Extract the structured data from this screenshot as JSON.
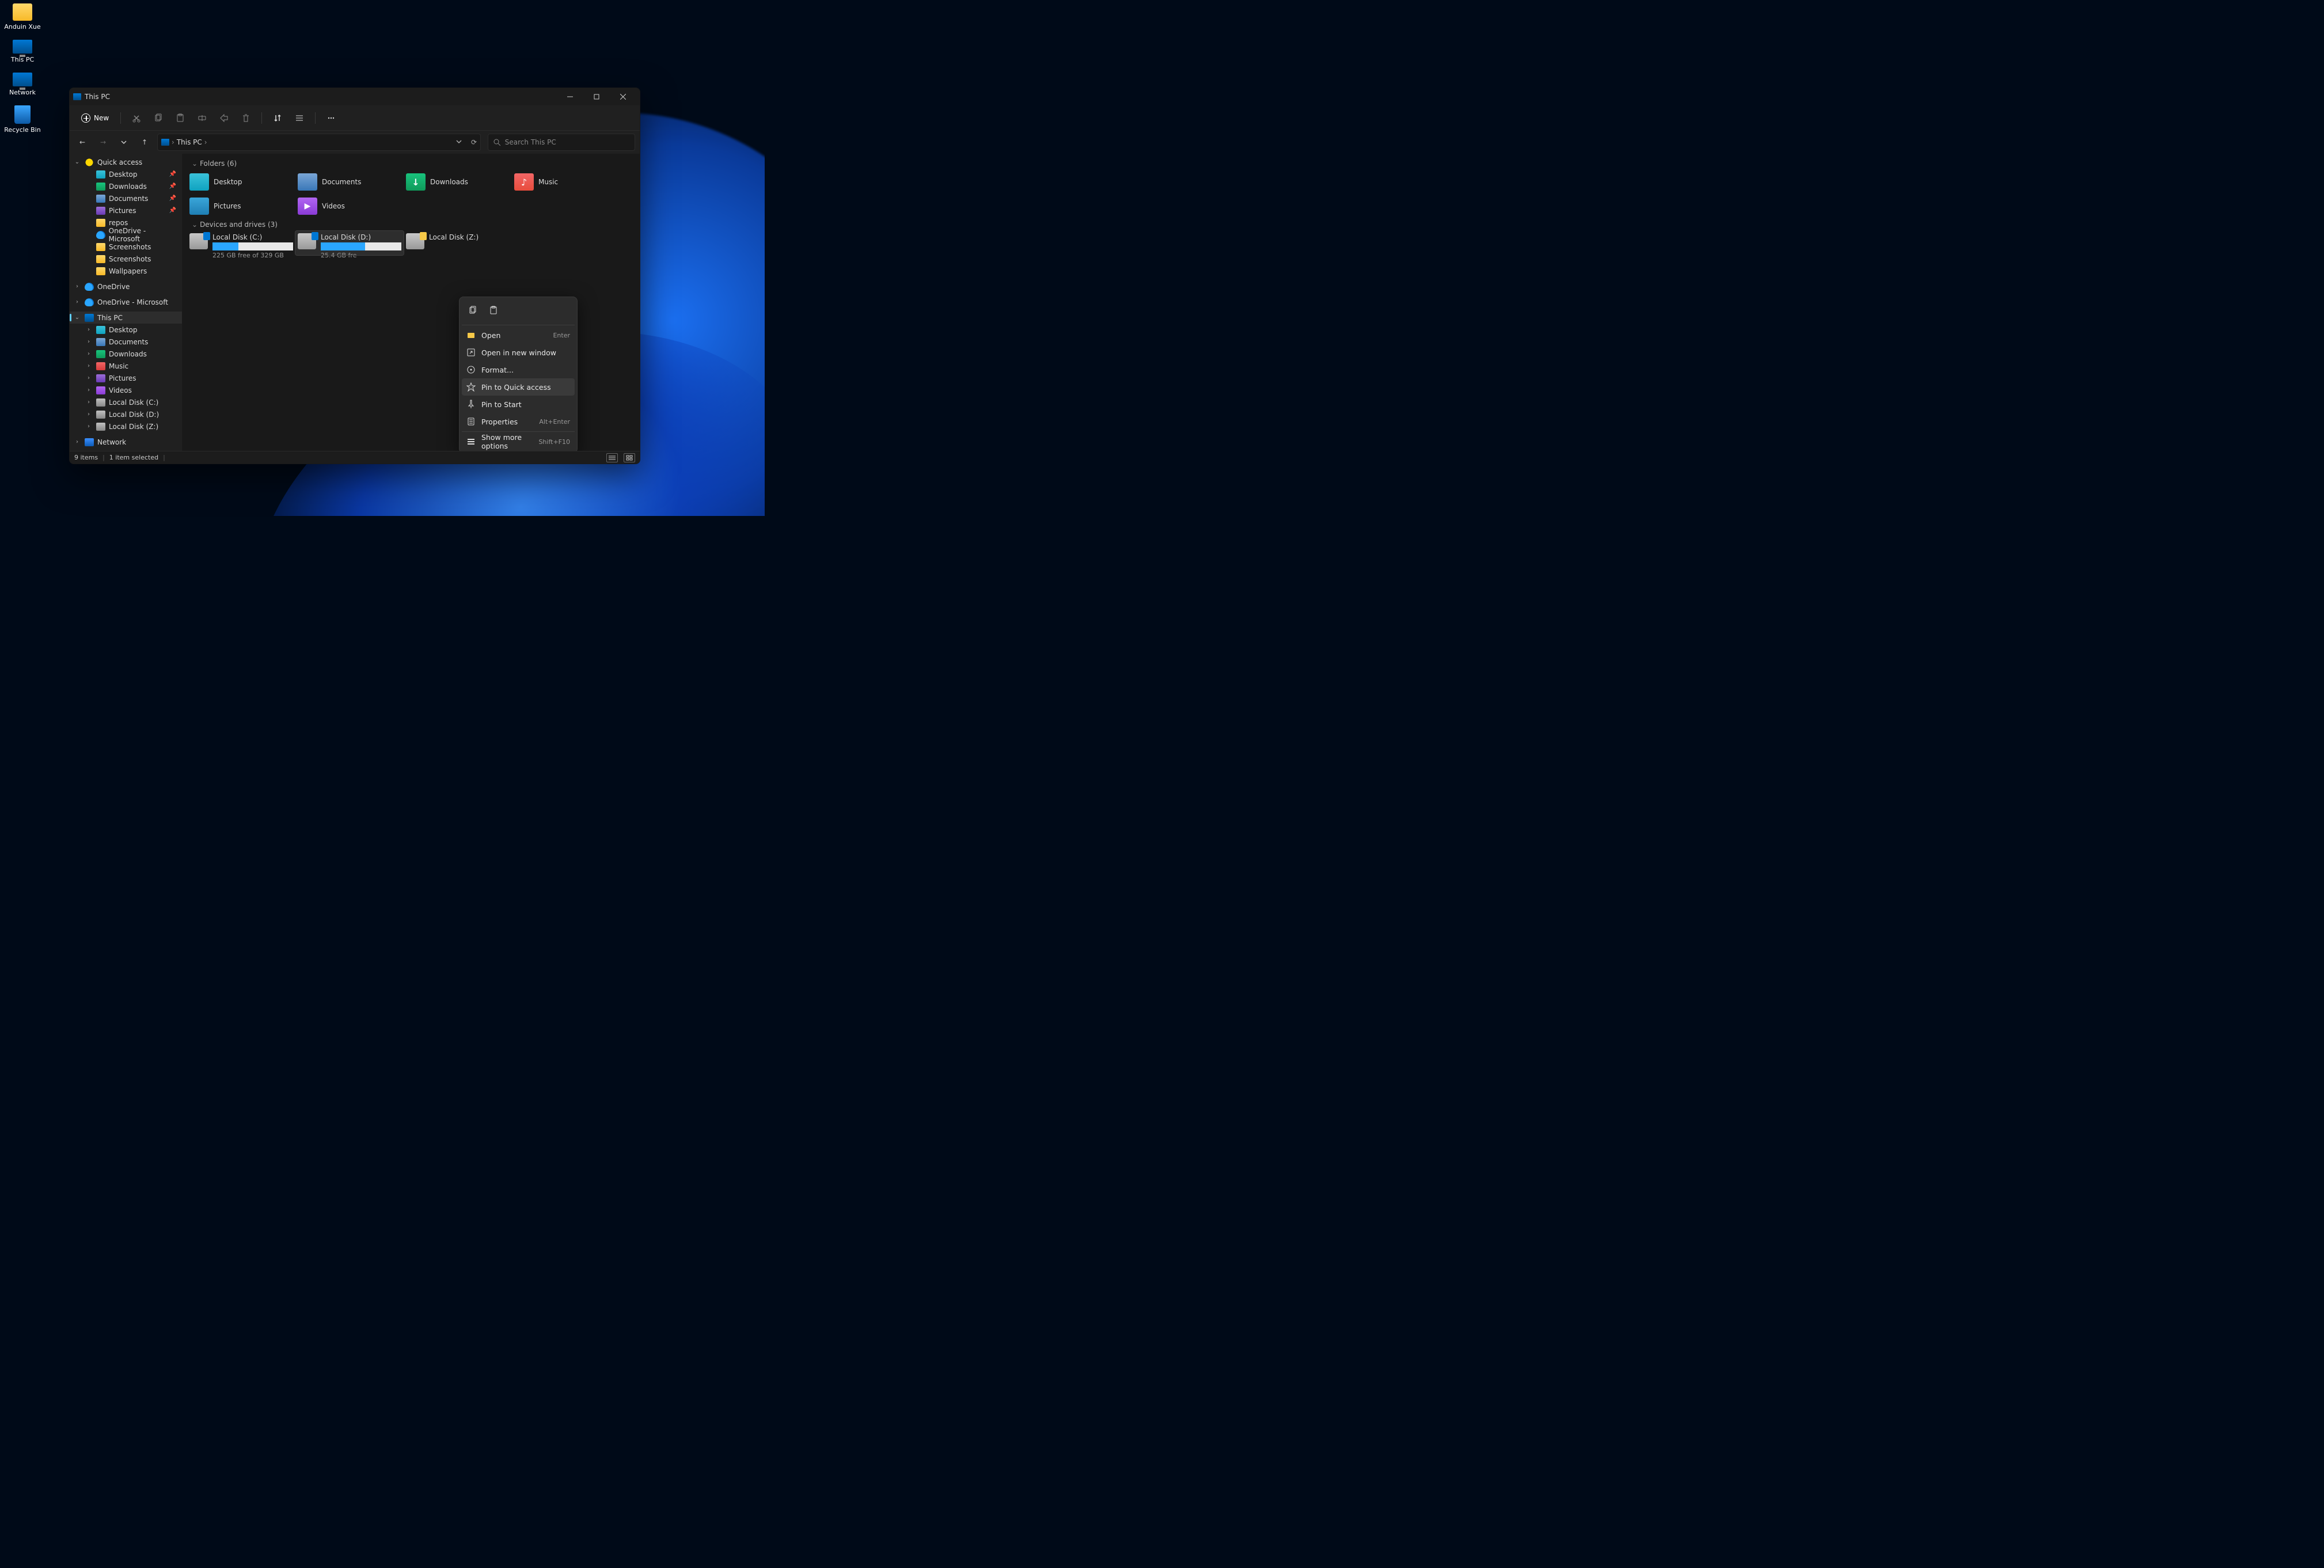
{
  "desktop": {
    "icons": [
      {
        "label": "Anduin Xue",
        "type": "folder"
      },
      {
        "label": "This PC",
        "type": "pc"
      },
      {
        "label": "Network",
        "type": "network"
      },
      {
        "label": "Recycle Bin",
        "type": "bin"
      }
    ]
  },
  "window": {
    "title": "This PC",
    "toolbar": {
      "new_label": "New"
    },
    "breadcrumb": {
      "root": "This PC"
    },
    "search_placeholder": "Search This PC",
    "sidebar": {
      "quick_access": {
        "label": "Quick access"
      },
      "qa_items": [
        {
          "label": "Desktop",
          "pinned": true,
          "cls": "ic-desktop"
        },
        {
          "label": "Downloads",
          "pinned": true,
          "cls": "ic-downloads"
        },
        {
          "label": "Documents",
          "pinned": true,
          "cls": "ic-documents"
        },
        {
          "label": "Pictures",
          "pinned": true,
          "cls": "ic-pictures"
        },
        {
          "label": "repos",
          "pinned": false,
          "cls": "ic-folder"
        },
        {
          "label": "OneDrive - Microsoft",
          "pinned": false,
          "cls": "ic-onedrive"
        },
        {
          "label": "Screenshots",
          "pinned": false,
          "cls": "ic-folder"
        },
        {
          "label": "Screenshots",
          "pinned": false,
          "cls": "ic-folder"
        },
        {
          "label": "Wallpapers",
          "pinned": false,
          "cls": "ic-folder"
        }
      ],
      "onedrive": {
        "label": "OneDrive"
      },
      "onedrive_ms": {
        "label": "OneDrive - Microsoft"
      },
      "thispc": {
        "label": "This PC"
      },
      "pc_items": [
        {
          "label": "Desktop",
          "cls": "ic-desktop"
        },
        {
          "label": "Documents",
          "cls": "ic-documents"
        },
        {
          "label": "Downloads",
          "cls": "ic-downloads"
        },
        {
          "label": "Music",
          "cls": "ic-music"
        },
        {
          "label": "Pictures",
          "cls": "ic-pictures"
        },
        {
          "label": "Videos",
          "cls": "ic-videos"
        },
        {
          "label": "Local Disk (C:)",
          "cls": "ic-disk"
        },
        {
          "label": "Local Disk (D:)",
          "cls": "ic-disk"
        },
        {
          "label": "Local Disk (Z:)",
          "cls": "ic-disk"
        }
      ],
      "network": {
        "label": "Network"
      }
    },
    "content": {
      "folders_header": "Folders (6)",
      "folders": [
        {
          "label": "Desktop",
          "cls": "fi-desktop"
        },
        {
          "label": "Documents",
          "cls": "fi-documents"
        },
        {
          "label": "Downloads",
          "cls": "fi-downloads"
        },
        {
          "label": "Music",
          "cls": "fi-music"
        },
        {
          "label": "Pictures",
          "cls": "fi-pictures"
        },
        {
          "label": "Videos",
          "cls": "fi-videos"
        }
      ],
      "drives_header": "Devices and drives (3)",
      "drives": [
        {
          "label": "Local Disk (C:)",
          "free": "225 GB free of 329 GB",
          "fill": 32,
          "locked": false
        },
        {
          "label": "Local Disk (D:)",
          "free": "25.4 GB fre",
          "fill": 55,
          "locked": false,
          "selected": true
        },
        {
          "label": "Local Disk (Z:)",
          "free": "",
          "fill": 0,
          "locked": true
        }
      ]
    },
    "statusbar": {
      "items_count": "9 items",
      "selection": "1 item selected"
    }
  },
  "context_menu": {
    "items": [
      {
        "label": "Open",
        "shortcut": "Enter",
        "icon": "open"
      },
      {
        "label": "Open in new window",
        "shortcut": "",
        "icon": "newwin"
      },
      {
        "label": "Format...",
        "shortcut": "",
        "icon": "format"
      },
      {
        "label": "Pin to Quick access",
        "shortcut": "",
        "icon": "star",
        "hover": true
      },
      {
        "label": "Pin to Start",
        "shortcut": "",
        "icon": "pin"
      },
      {
        "label": "Properties",
        "shortcut": "Alt+Enter",
        "icon": "props"
      }
    ],
    "more": {
      "label": "Show more options",
      "shortcut": "Shift+F10"
    }
  }
}
